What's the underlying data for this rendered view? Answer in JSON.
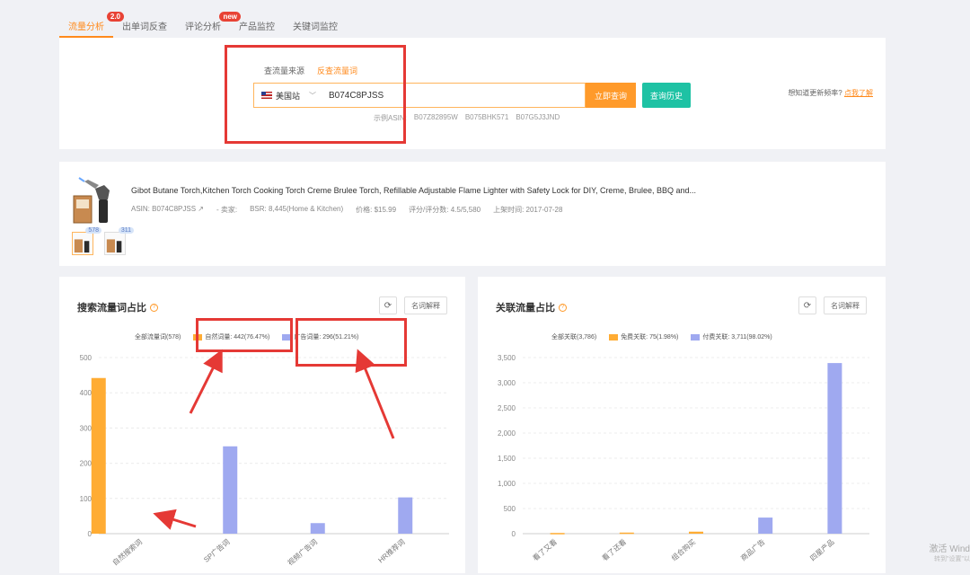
{
  "tabs": [
    {
      "label": "流量分析",
      "badge": "2.0",
      "active": true
    },
    {
      "label": "出单词反查",
      "badge": "",
      "active": false
    },
    {
      "label": "评论分析",
      "badge": "new",
      "active": false
    },
    {
      "label": "产品监控",
      "badge": "",
      "active": false
    },
    {
      "label": "关键词监控",
      "badge": "",
      "active": false
    }
  ],
  "search": {
    "sub_tabs": [
      "查流量来源",
      "反查流量词"
    ],
    "active_sub_tab": 1,
    "market": "美国站",
    "asin_value": "B074C8PJSS",
    "query_label": "立即查询",
    "history_label": "查询历史",
    "examples_label": "示例ASIN:",
    "examples": [
      "B07Z82895W",
      "B075BHK571",
      "B07G5J3JND"
    ],
    "hint_text": "想知道更新频率?",
    "hint_link": "点我了解"
  },
  "product": {
    "title": "Gibot Butane Torch,Kitchen Torch Cooking Torch Creme Brulee Torch, Refillable Adjustable Flame Lighter with Safety Lock for DIY, Creme, Brulee, BBQ and...",
    "asin": "ASIN: B074C8PJSS",
    "seller": "- 卖家:",
    "bsr": "BSR: 8,445(Home & Kitchen)",
    "price": "价格: $15.99",
    "rating": "评分/评分数: 4.5/5,580",
    "launch": "上架时间: 2017-07-28",
    "thumbs": [
      "578",
      "311"
    ]
  },
  "flow_panel": {
    "title": "搜索流量词占比",
    "refresh_icon": "⟳",
    "glossary_label": "名词解释",
    "legend": {
      "all": "全部流量词(578)",
      "natural": "自然词量: 442(76.47%)",
      "ad": "广告词量: 296(51.21%)"
    }
  },
  "assoc_panel": {
    "title": "关联流量占比",
    "refresh_icon": "⟳",
    "glossary_label": "名词解释",
    "legend": {
      "all": "全部关联(3,786)",
      "free": "免费关联: 75(1.98%)",
      "paid": "付费关联: 3,711(98.02%)"
    }
  },
  "colors": {
    "orange": "#ffac33",
    "purple": "#9fa9f0",
    "accent": "#ff8a1c",
    "teal": "#1ec2a4",
    "annotation_red": "#e53935"
  },
  "watermark": {
    "line1": "激活 Wind",
    "line2": "转到\"设置\"以"
  },
  "chart_data": [
    {
      "type": "bar",
      "categories": [
        "自然搜索词",
        "SP广告词",
        "视频广告词",
        "HR推荐词"
      ],
      "series": [
        {
          "name": "自然词量",
          "values": [
            442,
            0,
            0,
            0
          ],
          "color": "#ffac33"
        },
        {
          "name": "广告词量",
          "values": [
            0,
            248,
            30,
            103
          ],
          "color": "#9fa9f0"
        }
      ],
      "ylim": [
        0,
        500
      ],
      "yticks": [
        0,
        100,
        200,
        300,
        400,
        500
      ],
      "ytick_labels": [
        "0",
        "100",
        "200",
        "300",
        "400",
        "500"
      ],
      "grid": true
    },
    {
      "type": "bar",
      "categories": [
        "看了又看",
        "看了还看",
        "组合购买",
        "商品广告",
        "四星产品"
      ],
      "series": [
        {
          "name": "免费关联",
          "values": [
            14,
            22,
            40,
            0,
            0
          ],
          "color": "#ffac33"
        },
        {
          "name": "付费关联",
          "values": [
            0,
            0,
            0,
            320,
            3391
          ],
          "color": "#9fa9f0"
        }
      ],
      "ylim": [
        0,
        3500
      ],
      "yticks": [
        0,
        500,
        1000,
        1500,
        2000,
        2500,
        3000,
        3500
      ],
      "ytick_labels": [
        "0",
        "500",
        "1,000",
        "1,500",
        "2,000",
        "2,500",
        "3,000",
        "3,500"
      ],
      "grid": true
    }
  ]
}
